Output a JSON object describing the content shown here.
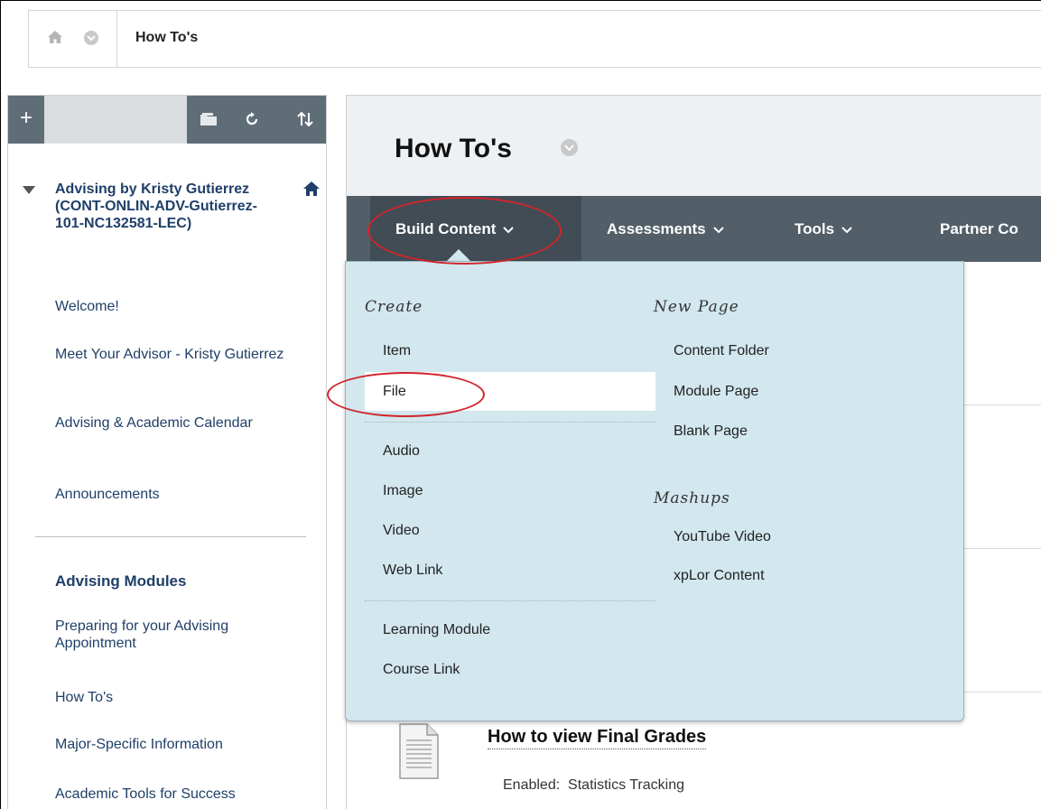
{
  "breadcrumb": {
    "current": "How To's"
  },
  "course_menu": {
    "course_title": "Advising by Kristy Gutierrez (CONT-ONLIN-ADV-Gutierrez-101-NC132581-LEC)",
    "items": [
      "Welcome!",
      "Meet Your Advisor - Kristy Gutierrez",
      "Advising & Academic Calendar",
      "Announcements"
    ],
    "section_heading": "Advising Modules",
    "section_items": [
      "Preparing for your Advising Appointment",
      "How To's",
      "Major-Specific Information",
      "Academic Tools for Success"
    ]
  },
  "page": {
    "title": "How To's"
  },
  "action_bar": {
    "build_content": "Build Content",
    "assessments": "Assessments",
    "tools": "Tools",
    "partner_content": "Partner Co"
  },
  "build_menu": {
    "create_heading": "Create",
    "create_group_1": [
      "Item",
      "File"
    ],
    "create_group_2": [
      "Audio",
      "Image",
      "Video",
      "Web Link"
    ],
    "create_group_3": [
      "Learning Module",
      "Course Link"
    ],
    "new_page_heading": "New Page",
    "new_page_items": [
      "Content Folder",
      "Module Page",
      "Blank Page"
    ],
    "mashups_heading": "Mashups",
    "mashups_items": [
      "YouTube Video",
      "xpLor Content"
    ]
  },
  "content_item": {
    "title": "How to view Final Grades",
    "meta": "Enabled:  Statistics Tracking"
  },
  "colors": {
    "action_bar": "#525f68",
    "menu_link": "#1f3f68",
    "dropdown_bg": "#d2e7ee",
    "annotation_red": "#d2232a"
  }
}
